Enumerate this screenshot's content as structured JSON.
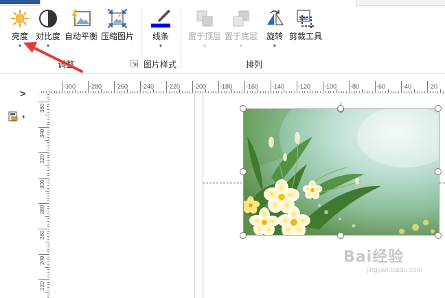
{
  "ribbon": {
    "tools": [
      {
        "id": "brightness",
        "label": "亮度",
        "icon": "sun-icon",
        "has_dropdown": true,
        "enabled": true
      },
      {
        "id": "contrast",
        "label": "对比度",
        "icon": "contrast-icon",
        "has_dropdown": true,
        "enabled": true
      },
      {
        "id": "auto-balance",
        "label": "自动平衡",
        "icon": "auto-balance-icon",
        "has_dropdown": false,
        "enabled": true
      },
      {
        "id": "compress",
        "label": "压缩图片",
        "icon": "compress-image-icon",
        "has_dropdown": false,
        "enabled": true
      },
      {
        "id": "line",
        "label": "线条",
        "icon": "pen-line-icon",
        "has_dropdown": true,
        "enabled": true
      },
      {
        "id": "bring-front",
        "label": "置于顶层",
        "icon": "bring-to-front-icon",
        "has_dropdown": true,
        "enabled": false
      },
      {
        "id": "send-back",
        "label": "置于底层",
        "icon": "send-to-back-icon",
        "has_dropdown": true,
        "enabled": false
      },
      {
        "id": "rotate",
        "label": "旋转",
        "icon": "rotate-flip-icon",
        "has_dropdown": true,
        "enabled": true
      },
      {
        "id": "crop",
        "label": "剪裁工具",
        "icon": "crop-icon",
        "has_dropdown": false,
        "enabled": true
      }
    ],
    "groups": [
      {
        "label": "调整"
      },
      {
        "label": "图片样式"
      },
      {
        "label": "排列"
      }
    ],
    "line_color": "#0000ff",
    "accent_color": "#2b579a"
  },
  "rulers": {
    "horizontal": [
      "-300",
      "-280",
      "-260",
      "-240",
      "-220",
      "-200",
      "-180",
      "-160",
      "-140",
      "-120",
      "-100",
      "-80",
      "-60",
      "-40",
      "-20"
    ],
    "vertical": [
      "360",
      "340",
      "320",
      "300",
      "280",
      "260",
      "240",
      "220"
    ]
  },
  "annotation": {
    "arrow_color": "#e53935"
  },
  "watermark": {
    "main": "Bai经验",
    "sub": "jingyan.baidu.com"
  }
}
